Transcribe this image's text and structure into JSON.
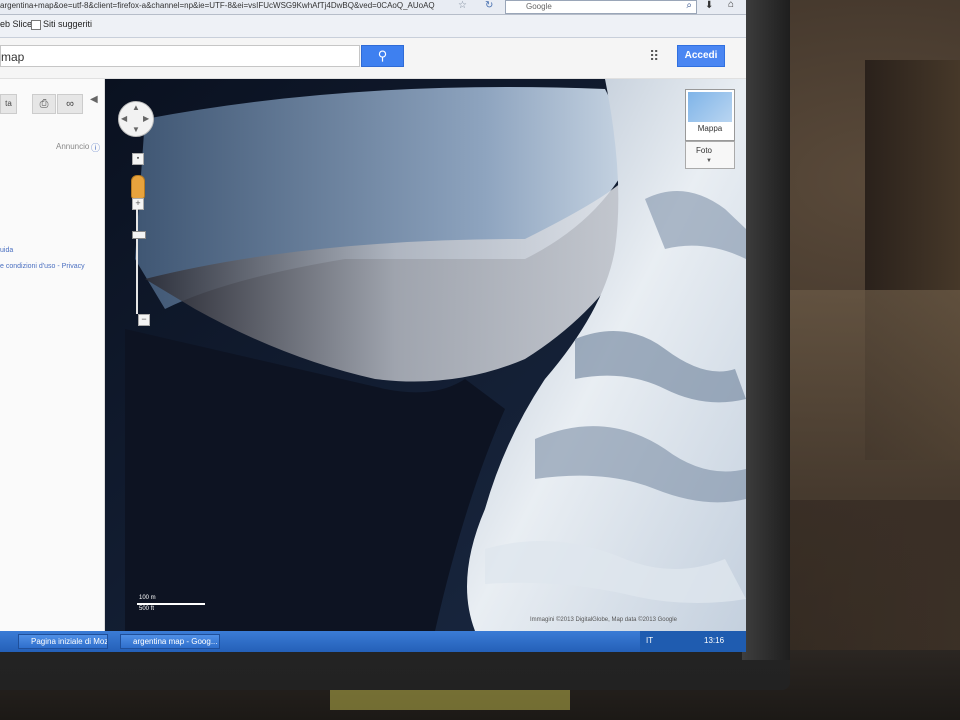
{
  "browser": {
    "url": "argentina+map&oe=utf-8&client=firefox-a&channel=np&ie=UTF-8&ei=vsIFUcWSG9KwhAfTj4DwBQ&ved=0CAoQ_AUoAQ",
    "web_search_label": "Google",
    "bookmarks": [
      {
        "label": "eb Slice"
      },
      {
        "label": "Siti suggeriti"
      }
    ]
  },
  "google": {
    "search_value": "map",
    "signin_label": "Accedi"
  },
  "left_panel": {
    "ads_label": "Annuncio",
    "help_link": "uida",
    "terms_link": "e condizioni d'uso - Privacy"
  },
  "map": {
    "map_type_label": "Mappa",
    "photos_label": "Foto",
    "scale_metric": "100 m",
    "scale_imperial": "500 ft",
    "attribution": "Immagini ©2013 DigitalGlobe, Map data ©2013 Google"
  },
  "taskbar": {
    "tasks": [
      {
        "label": "Pagina iniziale di Mozil..."
      },
      {
        "label": "argentina map - Goog..."
      }
    ],
    "language": "IT",
    "clock": "13:16"
  },
  "colors": {
    "accent": "#4a86f2",
    "taskbar": "#2a66c0"
  }
}
